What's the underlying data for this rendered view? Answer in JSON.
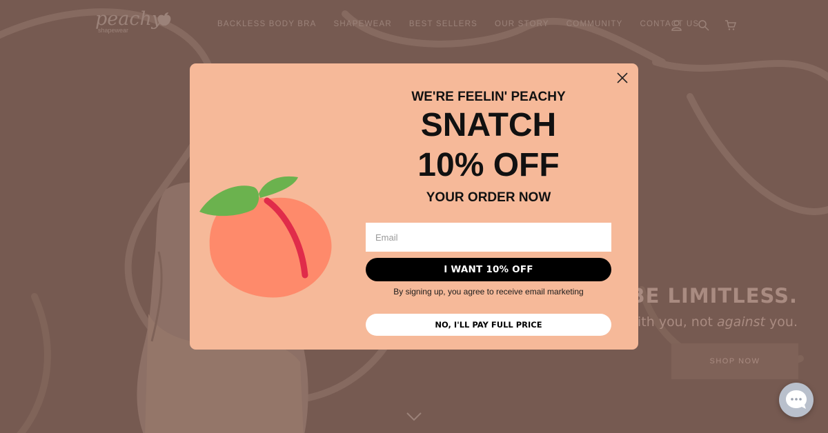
{
  "header": {
    "logo_word": "peachy",
    "logo_sub": "shapewear",
    "nav": [
      {
        "label": "BACKLESS BODY BRA"
      },
      {
        "label": "SHAPEWEAR"
      },
      {
        "label": "BEST SELLERS"
      },
      {
        "label": "OUR STORY"
      },
      {
        "label": "COMMUNITY"
      },
      {
        "label": "CONTACT US"
      }
    ],
    "icons": [
      "account-icon",
      "search-icon",
      "cart-icon"
    ]
  },
  "hero": {
    "headline": "BE LIMITLESS.",
    "sub_prefix": "with you, not ",
    "sub_emph": "against",
    "sub_suffix": " you.",
    "shop_label": "SHOP NOW"
  },
  "modal": {
    "eyebrow": "WE'RE FEELIN' PEACHY",
    "big1": "SNATCH",
    "big2": "10% OFF",
    "tail": "YOUR ORDER NOW",
    "email_placeholder": "Email",
    "cta_label": "I WANT 10% OFF",
    "consent": "By signing up, you agree to receive email marketing",
    "decline_label": "NO, I'LL PAY FULL PRICE"
  },
  "colors": {
    "modal_bg": "#f6b999",
    "backdrop": "#765a51",
    "cta_bg": "#000000",
    "peach_body": "#fe8a6b",
    "peach_leaf": "#6bb24e",
    "peach_crease": "#e02c4a"
  }
}
